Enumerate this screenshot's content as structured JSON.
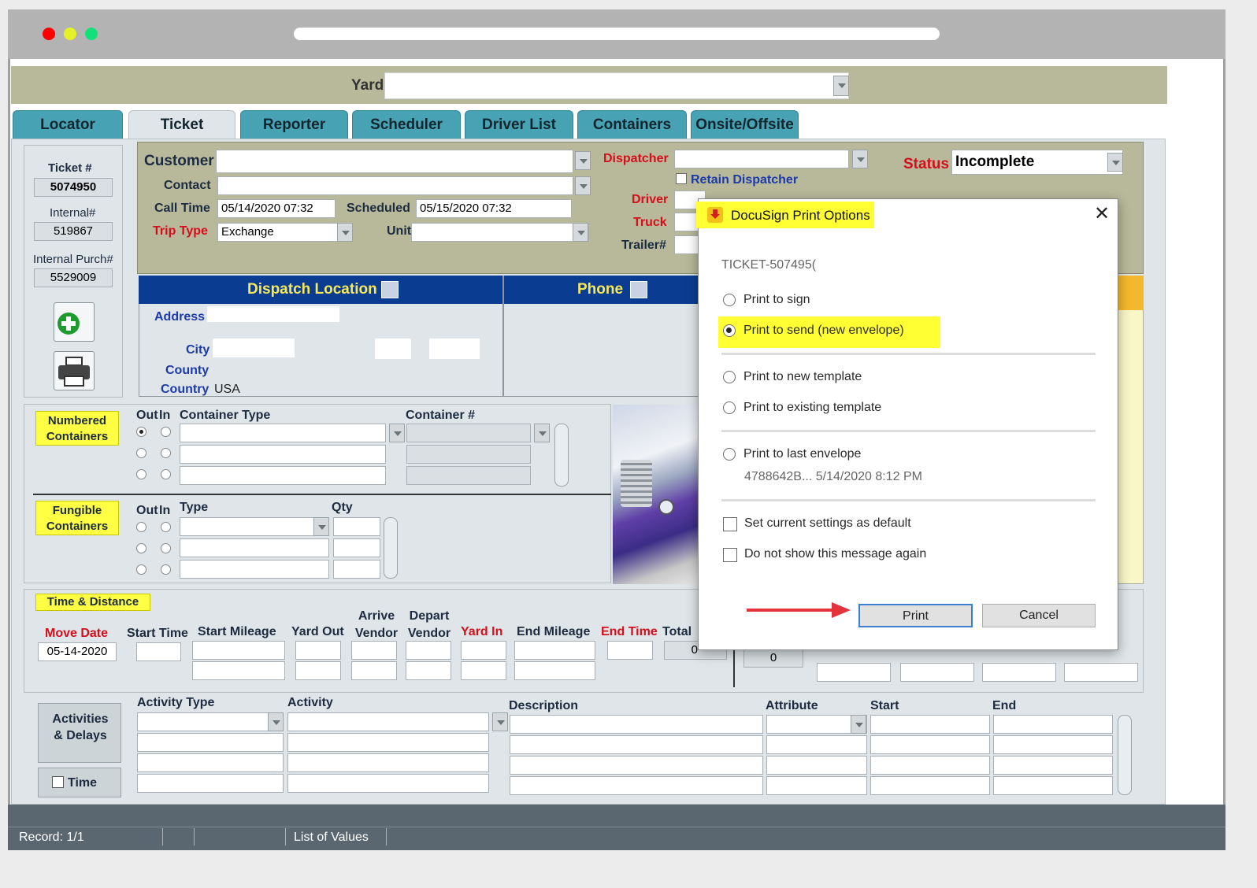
{
  "window": {
    "controls": [
      "close",
      "minimize",
      "maximize"
    ]
  },
  "header": {
    "yard_label": "Yard"
  },
  "tabs": [
    "Locator",
    "Ticket",
    "Reporter",
    "Scheduler",
    "Driver List",
    "Containers",
    "Onsite/Offsite"
  ],
  "ids": {
    "ticket_label": "Ticket #",
    "ticket_value": "5074950",
    "internal_label": "Internal#",
    "internal_value": "519867",
    "purch_label": "Internal Purch#",
    "purch_value": "5529009"
  },
  "form": {
    "customer": "Customer",
    "contact": "Contact",
    "call_time": "Call Time",
    "call_time_value": "05/14/2020 07:32",
    "scheduled": "Scheduled",
    "scheduled_value": "05/15/2020 07:32",
    "trip_type": "Trip Type",
    "trip_type_value": "Exchange",
    "unit": "Unit",
    "dispatcher": "Dispatcher",
    "retain_dispatcher": "Retain Dispatcher",
    "driver": "Driver",
    "truck": "Truck",
    "trailer": "Trailer#",
    "status": "Status",
    "status_value": "Incomplete"
  },
  "dispatch": {
    "title": "Dispatch Location",
    "phone": "Phone",
    "address": "Address",
    "city": "City",
    "county": "County",
    "country": "Country",
    "country_value": "USA"
  },
  "numbered": {
    "label": "Numbered Containers",
    "out": "Out",
    "in": "In",
    "container_type": "Container Type",
    "container_no": "Container #"
  },
  "fungible": {
    "label": "Fungible Containers",
    "out": "Out",
    "in": "In",
    "type": "Type",
    "qty": "Qty"
  },
  "time": {
    "label": "Time &  Distance",
    "move_date": "Move Date",
    "move_date_value": "05-14-2020",
    "start_time": "Start Time",
    "start_mileage": "Start Mileage",
    "yard_out": "Yard Out",
    "arrive_vendor": "Arrive Vendor",
    "depart_vendor": "Depart Vendor",
    "yard_in": "Yard In",
    "end_mileage": "End Mileage",
    "end_time": "End Time",
    "total": "Total",
    "total_value": "0",
    "zero": "0"
  },
  "activities": {
    "label": "Activities & Delays",
    "time": "Time",
    "activity_type": "Activity Type",
    "activity": "Activity",
    "description": "Description",
    "attribute": "Attribute",
    "start": "Start",
    "end": "End"
  },
  "status_bar": {
    "record": "Record: 1/1",
    "lov": "List of Values"
  },
  "dialog": {
    "title": "DocuSign Print Options",
    "ticket": "TICKET-507495(",
    "options": [
      "Print to sign",
      "Print to send (new envelope)",
      "Print to new template",
      "Print to existing template",
      "Print to last envelope"
    ],
    "selected": 1,
    "envelope": "4788642B... 5/14/2020 8:12 PM",
    "set_default": "Set current settings as default",
    "dont_show": "Do not show this message again",
    "print": "Print",
    "cancel": "Cancel",
    "highlight": "#ffff33"
  },
  "colors": {
    "teal": "#47a3b3",
    "navy": "#0a3d91",
    "olive": "#b8b89a",
    "red_arrow": "#e5333c"
  }
}
